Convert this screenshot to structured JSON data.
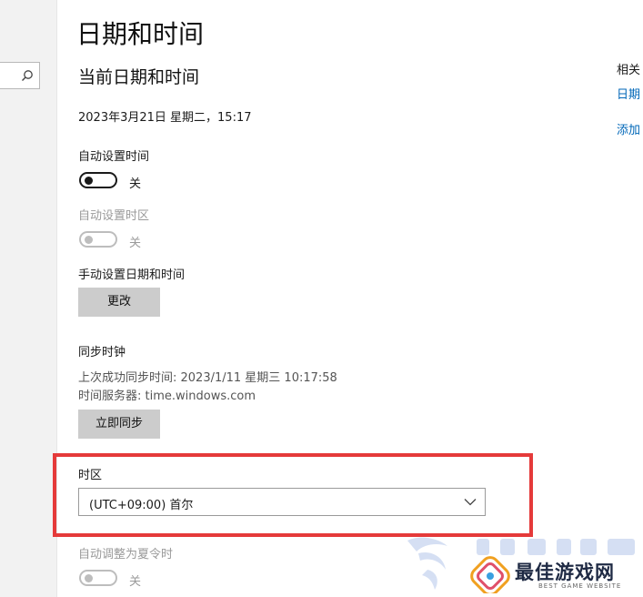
{
  "page": {
    "title": "日期和时间",
    "section_title": "当前日期和时间",
    "current_datetime": "2023年3月21日 星期二，15:17"
  },
  "auto_time": {
    "label": "自动设置时间",
    "state_text": "关",
    "on": false
  },
  "auto_timezone": {
    "label": "自动设置时区",
    "state_text": "关",
    "on": false,
    "disabled": true
  },
  "manual": {
    "label": "手动设置日期和时间",
    "button": "更改"
  },
  "sync": {
    "label": "同步时钟",
    "last_sync": "上次成功同步时间: 2023/1/11 星期三 10:17:58",
    "server": "时间服务器: time.windows.com",
    "button": "立即同步"
  },
  "timezone": {
    "label": "时区",
    "selected": "(UTC+09:00) 首尔"
  },
  "dst": {
    "label": "自动调整为夏令时",
    "state_text": "关",
    "on": false,
    "disabled": true
  },
  "related": {
    "heading": "相关",
    "links": [
      "日期",
      "添加"
    ]
  },
  "watermark": {
    "text": "最佳游戏网",
    "sub": "BEST GAME WEBSITE"
  },
  "colors": {
    "accent": "#0067b8",
    "highlight": "#e53a3a",
    "button_bg": "#cccccc"
  }
}
